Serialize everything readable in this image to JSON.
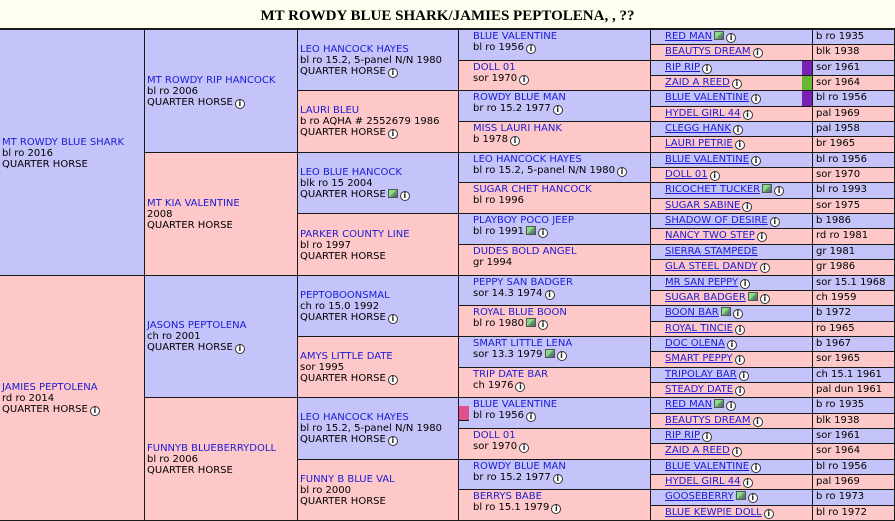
{
  "page": {
    "title": "MT ROWDY BLUE SHARK/JAMIES PEPTOLENA, , ??"
  },
  "colors": {
    "male": "#c4c4fa",
    "female": "#ffc8c8",
    "link": "#1b1bd6",
    "green_marker": "#66b832",
    "purple_marker": "#7a1fb0",
    "pink_marker": "#e0508c"
  },
  "gen1": [
    {
      "name": "MT ROWDY BLUE SHARK",
      "info": "bl ro 2016",
      "breed": "QUARTER HORSE",
      "icons": []
    },
    {
      "name": "JAMIES PEPTOLENA",
      "info": "rd ro 2014",
      "breed": "QUARTER HORSE",
      "icons": [
        "info-icon"
      ]
    }
  ],
  "gen2": [
    {
      "name": "MT ROWDY RIP HANCOCK",
      "info": "bl ro 2006",
      "breed": "QUARTER HORSE",
      "icons": [
        "info-icon"
      ]
    },
    {
      "name": "MT KIA VALENTINE",
      "info": "2008",
      "breed": "QUARTER HORSE",
      "icons": []
    },
    {
      "name": "JASONS PEPTOLENA",
      "info": "ch ro 2001",
      "breed": "QUARTER HORSE",
      "icons": [
        "info-icon"
      ]
    },
    {
      "name": "FUNNYB BLUEBERRYDOLL",
      "info": "bl ro 2006",
      "breed": "QUARTER HORSE",
      "icons": []
    }
  ],
  "gen3": [
    {
      "name": "LEO HANCOCK HAYES",
      "info": "bl ro 15.2, 5-panel N/N 1980",
      "breed": "QUARTER HORSE",
      "icons": [
        "info-icon"
      ]
    },
    {
      "name": "LAURI BLEU",
      "info": "b ro AQHA # 2552679 1986",
      "breed": "QUARTER HORSE",
      "icons": [
        "info-icon"
      ]
    },
    {
      "name": "LEO BLUE HANCOCK",
      "info": "blk ro 15 2004",
      "breed": "QUARTER HORSE",
      "icons": [
        "photo-icon",
        "info-icon"
      ]
    },
    {
      "name": "PARKER COUNTY LINE",
      "info": "bl ro 1997",
      "breed": "QUARTER HORSE",
      "icons": []
    },
    {
      "name": "PEPTOBOONSMAL",
      "info": "ch ro 15.0 1992",
      "breed": "QUARTER HORSE",
      "icons": [
        "info-icon"
      ]
    },
    {
      "name": "AMYS LITTLE DATE",
      "info": "sor 1995",
      "breed": "QUARTER HORSE",
      "icons": [
        "info-icon"
      ]
    },
    {
      "name": "LEO HANCOCK HAYES",
      "info": "bl ro 15.2, 5-panel N/N 1980",
      "breed": "QUARTER HORSE",
      "icons": [
        "info-icon"
      ]
    },
    {
      "name": "FUNNY B BLUE VAL",
      "info": "bl ro 2000",
      "breed": "QUARTER HORSE",
      "icons": []
    }
  ],
  "gen4": [
    {
      "name": "BLUE VALENTINE",
      "info": "bl ro 1956",
      "icons": [
        "info-icon"
      ]
    },
    {
      "name": "DOLL 01",
      "info": "sor 1970",
      "icons": [
        "info-icon"
      ]
    },
    {
      "name": "ROWDY BLUE MAN",
      "info": "br ro 15.2 1977",
      "icons": [
        "info-icon"
      ]
    },
    {
      "name": "MISS LAURI HANK",
      "info": "b 1978",
      "icons": [
        "info-icon"
      ]
    },
    {
      "name": "LEO HANCOCK HAYES",
      "info": "bl ro 15.2, 5-panel N/N 1980",
      "icons": [
        "info-icon"
      ]
    },
    {
      "name": "SUGAR CHET HANCOCK",
      "info": "bl ro 1996",
      "icons": []
    },
    {
      "name": "PLAYBOY POCO JEEP",
      "info": "bl ro 1991",
      "icons": [
        "photo-icon",
        "info-icon"
      ]
    },
    {
      "name": "DUDES BOLD ANGEL",
      "info": "gr 1994",
      "icons": []
    },
    {
      "name": "PEPPY SAN BADGER",
      "info": "sor 14.3 1974",
      "icons": [
        "info-icon"
      ]
    },
    {
      "name": "ROYAL BLUE BOON",
      "info": "bl ro 1980",
      "icons": [
        "photo-icon",
        "info-icon"
      ]
    },
    {
      "name": "SMART LITTLE LENA",
      "info": "sor 13.3 1979",
      "icons": [
        "photo-icon",
        "info-icon"
      ]
    },
    {
      "name": "TRIP DATE BAR",
      "info": "ch 1976",
      "icons": [
        "info-icon"
      ]
    },
    {
      "name": "BLUE VALENTINE",
      "info": "bl ro 1956",
      "icons": [
        "info-icon"
      ]
    },
    {
      "name": "DOLL 01",
      "info": "sor 1970",
      "icons": [
        "info-icon"
      ]
    },
    {
      "name": "ROWDY BLUE MAN",
      "info": "br ro 15.2 1977",
      "icons": [
        "info-icon"
      ]
    },
    {
      "name": "BERRYS BABE",
      "info": "bl ro 15.1 1979",
      "icons": [
        "info-icon"
      ]
    }
  ],
  "gen5": [
    {
      "name": "RED MAN",
      "info": "b ro 1935",
      "icons": [
        "photo-icon",
        "info-icon"
      ]
    },
    {
      "name": "BEAUTYS DREAM",
      "info": "blk 1938",
      "icons": [
        "info-icon"
      ]
    },
    {
      "name": "RIP RIP",
      "info": "sor 1961",
      "icons": [
        "info-icon"
      ]
    },
    {
      "name": "ZAID A REED",
      "info": "sor 1964",
      "icons": [
        "info-icon"
      ]
    },
    {
      "name": "BLUE VALENTINE",
      "info": "bl ro 1956",
      "icons": [
        "info-icon"
      ]
    },
    {
      "name": "HYDEL GIRL 44",
      "info": "pal 1969",
      "icons": [
        "info-icon"
      ]
    },
    {
      "name": "CLEGG HANK",
      "info": "pal 1958",
      "icons": [
        "info-icon"
      ]
    },
    {
      "name": "LAURI PETRIE",
      "info": "br 1965",
      "icons": [
        "info-icon"
      ]
    },
    {
      "name": "BLUE VALENTINE",
      "info": "bl ro 1956",
      "icons": [
        "info-icon"
      ]
    },
    {
      "name": "DOLL 01",
      "info": "sor 1970",
      "icons": [
        "info-icon"
      ]
    },
    {
      "name": "RICOCHET TUCKER",
      "info": "bl ro 1993",
      "icons": [
        "photo-icon",
        "info-icon"
      ]
    },
    {
      "name": "SUGAR SABINE",
      "info": "sor 1975",
      "icons": [
        "info-icon"
      ]
    },
    {
      "name": "SHADOW OF DESIRE",
      "info": "b 1986",
      "icons": [
        "info-icon"
      ]
    },
    {
      "name": "NANCY TWO STEP",
      "info": "rd ro 1981",
      "icons": [
        "info-icon"
      ]
    },
    {
      "name": "SIERRA STAMPEDE",
      "info": "gr 1981",
      "icons": []
    },
    {
      "name": "GLA STEEL DANDY",
      "info": "gr 1986",
      "icons": [
        "info-icon"
      ]
    },
    {
      "name": "MR SAN PEPPY",
      "info": "sor 15.1 1968",
      "icons": [
        "info-icon"
      ]
    },
    {
      "name": "SUGAR BADGER",
      "info": "ch 1959",
      "icons": [
        "photo-icon",
        "info-icon"
      ]
    },
    {
      "name": "BOON BAR",
      "info": "b 1972",
      "icons": [
        "photo-icon",
        "info-icon"
      ]
    },
    {
      "name": "ROYAL TINCIE",
      "info": "ro 1965",
      "icons": [
        "info-icon"
      ]
    },
    {
      "name": "DOC OLENA",
      "info": "b 1967",
      "icons": [
        "info-icon"
      ]
    },
    {
      "name": "SMART PEPPY",
      "info": "sor 1965",
      "icons": [
        "info-icon"
      ]
    },
    {
      "name": "TRIPOLAY BAR",
      "info": "ch 15.1 1961",
      "icons": [
        "info-icon"
      ]
    },
    {
      "name": "STEADY DATE",
      "info": "pal dun 1961",
      "icons": [
        "info-icon"
      ]
    },
    {
      "name": "RED MAN",
      "info": "b ro 1935",
      "icons": [
        "photo-icon",
        "info-icon"
      ]
    },
    {
      "name": "BEAUTYS DREAM",
      "info": "blk 1938",
      "icons": [
        "info-icon"
      ]
    },
    {
      "name": "RIP RIP",
      "info": "sor 1961",
      "icons": [
        "info-icon"
      ]
    },
    {
      "name": "ZAID A REED",
      "info": "sor 1964",
      "icons": [
        "info-icon"
      ]
    },
    {
      "name": "BLUE VALENTINE",
      "info": "bl ro 1956",
      "icons": [
        "info-icon"
      ]
    },
    {
      "name": "HYDEL GIRL 44",
      "info": "pal 1969",
      "icons": [
        "info-icon"
      ]
    },
    {
      "name": "GOOSEBERRY",
      "info": "b ro 1973",
      "icons": [
        "photo-icon",
        "info-icon"
      ]
    },
    {
      "name": "BLUE KEWPIE DOLL",
      "info": "bl ro 1972",
      "icons": [
        "info-icon"
      ]
    }
  ],
  "markers": [
    {
      "row": 4,
      "color": "purple_marker"
    },
    {
      "row": 6,
      "color": "green_marker"
    },
    {
      "row": 8,
      "color": "purple_marker"
    },
    {
      "row": 49,
      "color": "pink_marker"
    }
  ]
}
